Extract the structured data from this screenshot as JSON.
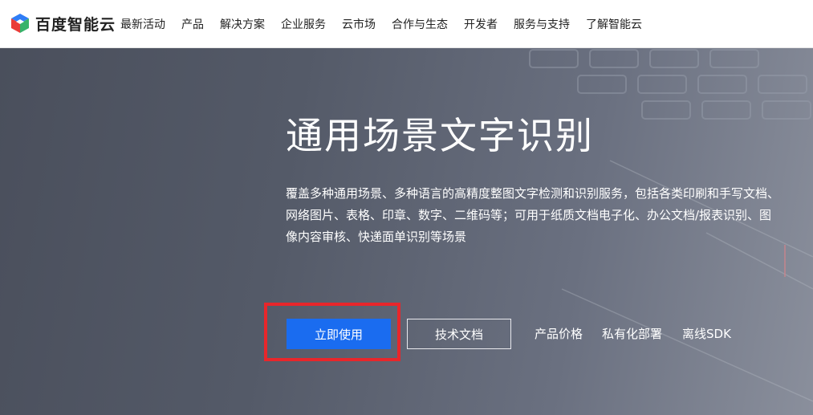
{
  "brand": {
    "name": "百度智能云",
    "logo_icon": "baidu-cloud-cube-icon"
  },
  "nav": {
    "items": [
      "最新活动",
      "产品",
      "解决方案",
      "企业服务",
      "云市场",
      "合作与生态",
      "开发者",
      "服务与支持",
      "了解智能云"
    ]
  },
  "hero": {
    "title": "通用场景文字识别",
    "description": "覆盖多种通用场景、多种语言的高精度整图文字检测和识别服务，包括各类印刷和手写文档、网络图片、表格、印章、数字、二维码等；可用于纸质文档电子化、办公文档/报表识别、图像内容审核、快递面单识别等场景",
    "primary_button": "立即使用",
    "secondary_button": "技术文档",
    "links": [
      "产品价格",
      "私有化部署",
      "离线SDK"
    ]
  },
  "colors": {
    "primary": "#1a6cf0",
    "highlight": "#e8262b"
  }
}
